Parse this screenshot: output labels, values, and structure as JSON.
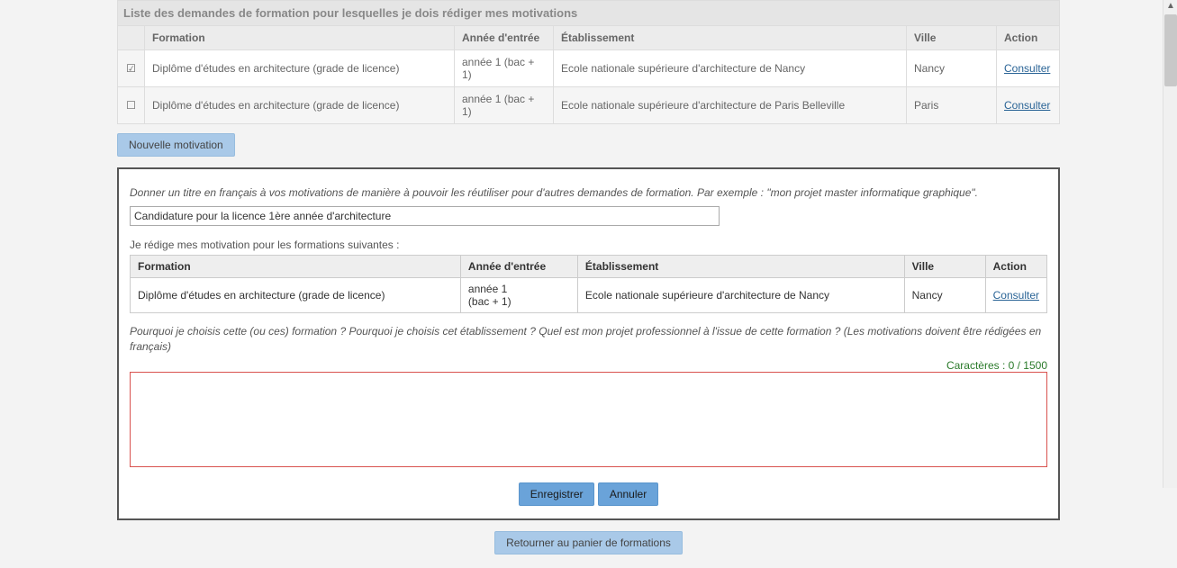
{
  "list": {
    "title": "Liste des demandes de formation pour lesquelles je dois rédiger mes motivations",
    "headers": {
      "formation": "Formation",
      "annee": "Année d'entrée",
      "etab": "Établissement",
      "ville": "Ville",
      "action": "Action"
    },
    "rows": [
      {
        "checked": "☑",
        "formation": "Diplôme d'études en architecture (grade de licence)",
        "annee": "année 1 (bac + 1)",
        "etab": "Ecole nationale supérieure d'architecture de Nancy",
        "ville": "Nancy",
        "action": "Consulter"
      },
      {
        "checked": "☐",
        "formation": "Diplôme d'études en architecture (grade de licence)",
        "annee": "année 1 (bac + 1)",
        "etab": "Ecole nationale supérieure d'architecture de Paris Belleville",
        "ville": "Paris",
        "action": "Consulter"
      }
    ]
  },
  "buttons": {
    "new_motivation": "Nouvelle motivation",
    "save": "Enregistrer",
    "cancel": "Annuler",
    "return_basket": "Retourner au panier de formations"
  },
  "panel": {
    "help_title": "Donner un titre en français à vos motivations de manière à pouvoir les réutiliser pour d'autres demandes de formation. Par exemple : \"mon projet master informatique graphique\".",
    "title_value": "Candidature pour la licence 1ère année d'architecture",
    "sub_label": "Je rédige mes motivation pour les formations suivantes :",
    "inner_headers": {
      "formation": "Formation",
      "annee": "Année d'entrée",
      "etab": "Établissement",
      "ville": "Ville",
      "action": "Action"
    },
    "inner_row": {
      "formation": "Diplôme d'études en architecture (grade de licence)",
      "annee": "année 1\n(bac + 1)",
      "etab": "Ecole nationale supérieure d'architecture de Nancy",
      "ville": "Nancy",
      "action": "Consulter"
    },
    "question": "Pourquoi je choisis cette (ou ces) formation ? Pourquoi je choisis cet établissement ? Quel est mon projet professionnel à l'issue de cette formation ? (Les motivations doivent être rédigées en français)",
    "char_count": "Caractères : 0 / 1500"
  }
}
